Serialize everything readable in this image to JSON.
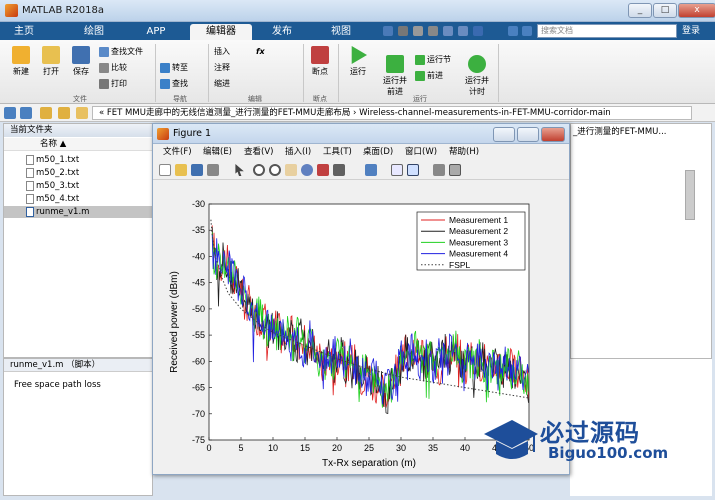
{
  "window": {
    "title": "MATLAB R2018a",
    "min": "_",
    "max": "□",
    "close": "x"
  },
  "ribbon_tabs": [
    {
      "label": "主页"
    },
    {
      "label": "绘图"
    },
    {
      "label": "APP"
    },
    {
      "label": "编辑器"
    },
    {
      "label": "发布"
    },
    {
      "label": "视图"
    }
  ],
  "search": {
    "placeholder": "搜索文档"
  },
  "login": "登录",
  "ribbon": {
    "file": {
      "new": "新建",
      "open": "打开",
      "save": "保存",
      "find_file": "查找文件",
      "compare": "比较",
      "print": "打印",
      "group": "文件"
    },
    "nav": {
      "goto": "转至",
      "find": "查找",
      "group": "导航"
    },
    "edit": {
      "insert": "插入",
      "comment": "注释",
      "indent": "缩进",
      "fx": "fx",
      "group": "编辑"
    },
    "breakpoints": {
      "label": "断点",
      "group": "断点"
    },
    "run": {
      "run": "运行",
      "run_advance": "运行并\n前进",
      "run_section": "运行节",
      "advance": "前进",
      "run_time": "运行并\n计时",
      "group": "运行"
    }
  },
  "address": {
    "path": "« FET MMU走廊中的无线信道测量_进行测量的FET-MMU走廊布局 › Wireless-channel-measurements-in-FET-MMU-corridor-main"
  },
  "current_folder": {
    "header": "当前文件夹",
    "name_col": "名称 ▲",
    "files": [
      {
        "name": "m50_1.txt"
      },
      {
        "name": "m50_2.txt"
      },
      {
        "name": "m50_3.txt"
      },
      {
        "name": "m50_4.txt"
      },
      {
        "name": "runme_v1.m"
      }
    ]
  },
  "script_info": {
    "header": "runme_v1.m （脚本）",
    "description": "Free space path loss"
  },
  "right_pane_text": "_进行测量的FET-MMU...",
  "figure": {
    "title": "Figure 1",
    "menu": [
      "文件(F)",
      "编辑(E)",
      "查看(V)",
      "插入(I)",
      "工具(T)",
      "桌面(D)",
      "窗口(W)",
      "帮助(H)"
    ]
  },
  "chart_data": {
    "type": "line",
    "xlabel": "Tx-Rx separation (m)",
    "ylabel": "Received power (dBm)",
    "xlim": [
      0,
      50
    ],
    "ylim": [
      -75,
      -30
    ],
    "xticks": [
      0,
      5,
      10,
      15,
      20,
      25,
      30,
      35,
      40,
      45,
      50
    ],
    "yticks": [
      -30,
      -35,
      -40,
      -45,
      -50,
      -55,
      -60,
      -65,
      -70,
      -75
    ],
    "legend_position": "top-right",
    "series": [
      {
        "name": "Measurement 1",
        "color": "#e02020"
      },
      {
        "name": "Measurement 2",
        "color": "#202020"
      },
      {
        "name": "Measurement 3",
        "color": "#20d020"
      },
      {
        "name": "Measurement 4",
        "color": "#2020e0"
      },
      {
        "name": "FSPL",
        "color": "#404040",
        "style": "dotted"
      }
    ],
    "anchors_x": [
      0.5,
      1,
      2,
      3,
      4,
      5,
      6,
      8,
      10,
      12,
      14,
      16,
      18,
      20,
      22,
      24,
      26,
      28,
      30,
      32,
      34,
      36,
      38,
      40,
      42,
      44,
      46,
      48,
      50
    ],
    "anchors_y": [
      -38,
      -40,
      -41,
      -42,
      -45,
      -46,
      -49,
      -52,
      -54,
      -55,
      -56,
      -57,
      -60,
      -59,
      -60,
      -62,
      -64,
      -66,
      -60,
      -58,
      -60,
      -60,
      -58,
      -60,
      -60,
      -61,
      -61,
      -62,
      -64
    ],
    "fspl_x": [
      0.3,
      0.5,
      1,
      2,
      3,
      5,
      8,
      10,
      15,
      20,
      25,
      30,
      35,
      40,
      45,
      50
    ],
    "fspl_y": [
      -33,
      -36,
      -40,
      -44,
      -47,
      -50,
      -53,
      -54.5,
      -57,
      -59.5,
      -61.5,
      -63,
      -64,
      -65,
      -66,
      -67
    ]
  },
  "watermark": {
    "brand": "必过源码",
    "url": "Biguo100.com"
  }
}
